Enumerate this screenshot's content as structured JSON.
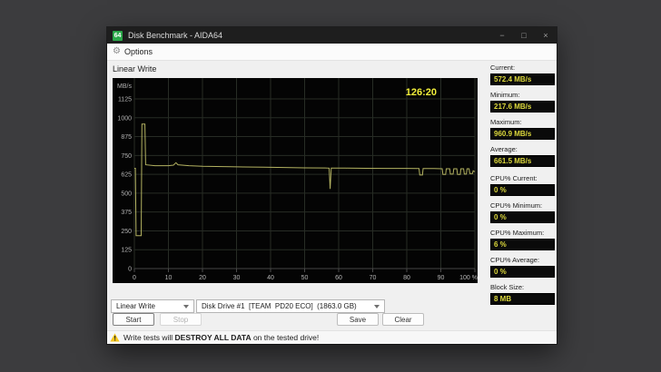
{
  "window": {
    "title": "Disk Benchmark - AIDA64",
    "icon_text": "64",
    "controls": {
      "minimize": "−",
      "maximize": "□",
      "close": "×"
    }
  },
  "menu": {
    "options_label": "Options"
  },
  "benchmark": {
    "test_label": "Linear Write"
  },
  "chart_data": {
    "type": "line",
    "title": "Linear Write",
    "ylabel": "MB/s",
    "xlabel": "",
    "x_unit": "%",
    "xlim": [
      0,
      100
    ],
    "ylim": [
      0,
      1125
    ],
    "grid": true,
    "legend": "none",
    "elapsed_time": "126:20",
    "x_ticks": [
      0,
      10,
      20,
      30,
      40,
      50,
      60,
      70,
      80,
      90,
      100
    ],
    "x_tick_labels": [
      "0",
      "10",
      "20",
      "30",
      "40",
      "50",
      "60",
      "70",
      "80",
      "90",
      "100 %"
    ],
    "y_ticks": [
      0,
      125,
      250,
      375,
      500,
      625,
      750,
      875,
      1000,
      1125
    ],
    "points": [
      [
        0,
        665
      ],
      [
        0.3,
        665
      ],
      [
        0.5,
        218
      ],
      [
        2.0,
        218
      ],
      [
        2.2,
        958
      ],
      [
        3.1,
        958
      ],
      [
        3.3,
        688
      ],
      [
        6,
        682
      ],
      [
        10,
        682
      ],
      [
        11.5,
        686
      ],
      [
        12.2,
        702
      ],
      [
        12.8,
        688
      ],
      [
        16,
        682
      ],
      [
        20,
        678
      ],
      [
        26,
        676
      ],
      [
        32,
        674
      ],
      [
        38,
        672
      ],
      [
        44,
        670
      ],
      [
        50,
        668
      ],
      [
        56,
        667
      ],
      [
        57.2,
        666
      ],
      [
        57.5,
        528
      ],
      [
        57.8,
        666
      ],
      [
        62,
        666
      ],
      [
        68,
        665
      ],
      [
        74,
        664
      ],
      [
        80,
        664
      ],
      [
        83.6,
        663
      ],
      [
        83.8,
        620
      ],
      [
        84.6,
        620
      ],
      [
        84.8,
        663
      ],
      [
        88,
        663
      ],
      [
        90.4,
        662
      ],
      [
        90.6,
        624
      ],
      [
        91.4,
        624
      ],
      [
        91.6,
        662
      ],
      [
        92.6,
        662
      ],
      [
        92.8,
        626
      ],
      [
        93.6,
        626
      ],
      [
        93.8,
        662
      ],
      [
        94.7,
        662
      ],
      [
        94.9,
        624
      ],
      [
        95.7,
        624
      ],
      [
        95.9,
        662
      ],
      [
        96.7,
        662
      ],
      [
        96.9,
        626
      ],
      [
        97.5,
        626
      ],
      [
        97.7,
        662
      ],
      [
        98.3,
        662
      ],
      [
        98.5,
        630
      ],
      [
        99.3,
        630
      ],
      [
        99.5,
        648
      ],
      [
        100,
        642
      ]
    ]
  },
  "stats": [
    {
      "label": "Current:",
      "value": "572.4 MB/s"
    },
    {
      "label": "Minimum:",
      "value": "217.6 MB/s"
    },
    {
      "label": "Maximum:",
      "value": "960.9 MB/s"
    },
    {
      "label": "Average:",
      "value": "661.5 MB/s"
    },
    {
      "label": "CPU% Current:",
      "value": "0 %"
    },
    {
      "label": "CPU% Minimum:",
      "value": "0 %"
    },
    {
      "label": "CPU% Maximum:",
      "value": "6 %"
    },
    {
      "label": "CPU% Average:",
      "value": "0 %"
    },
    {
      "label": "Block Size:",
      "value": "8 MB"
    }
  ],
  "controls": {
    "test_select": "Linear Write",
    "drive_select": "Disk Drive #1  [TEAM  PD20 ECO]  (1863.0 GB)",
    "start_label": "Start",
    "stop_label": "Stop",
    "save_label": "Save",
    "clear_label": "Clear"
  },
  "warning": {
    "prefix": "Write tests will ",
    "emphasis": "DESTROY ALL DATA",
    "suffix": " on the tested drive!"
  },
  "colors": {
    "line": "#b3b261",
    "elapsed": "#f2ef3a",
    "grid": "#272c25",
    "axis_text": "#b4b4b4",
    "value_text": "#dcd83c",
    "app_icon_green": "#2ba84a",
    "warning_yellow": "#f6c61c"
  }
}
